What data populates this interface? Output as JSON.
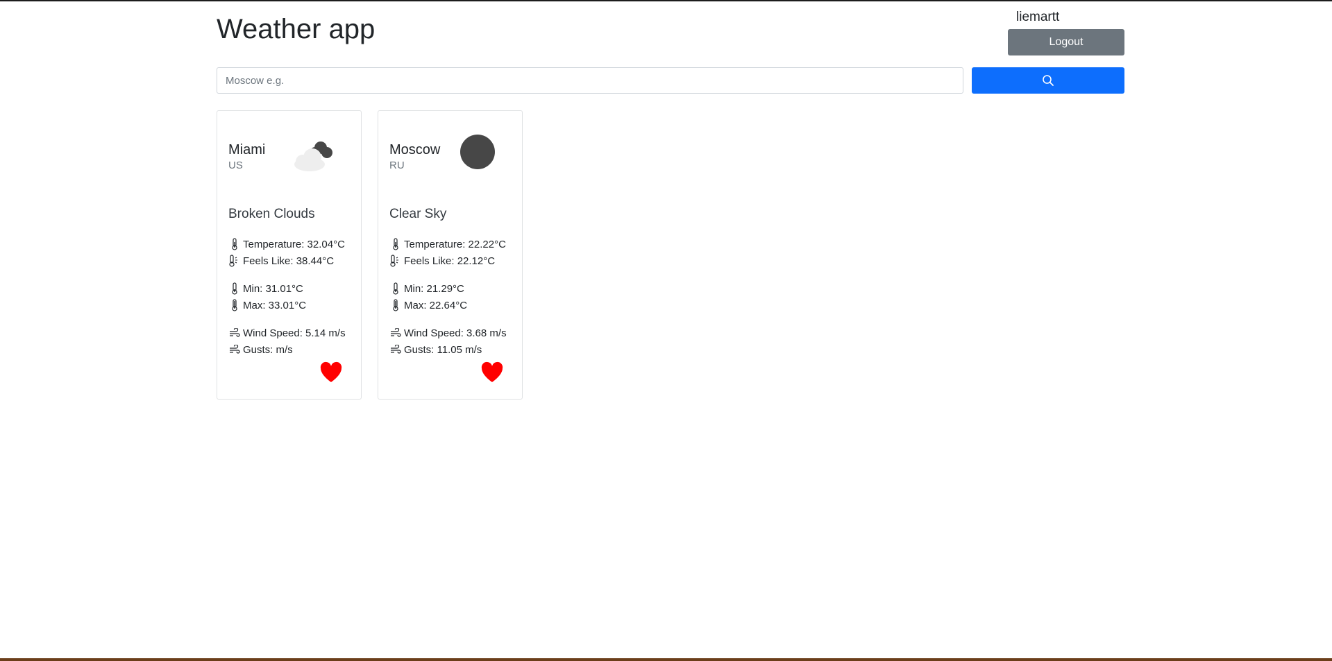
{
  "header": {
    "title": "Weather app",
    "username": "liemartt",
    "logout_label": "Logout"
  },
  "search": {
    "placeholder": "Moscow e.g.",
    "value": "",
    "button_icon": "search-icon"
  },
  "colors": {
    "primary": "#0d6efd",
    "secondary": "#6c757d",
    "favorite": "#ff0000",
    "icon_dark": "#474747"
  },
  "cards": [
    {
      "city": "Miami",
      "country": "US",
      "icon": "broken-clouds-icon",
      "description": "Broken Clouds",
      "temperature": "Temperature: 32.04°C",
      "feels_like": "Feels Like: 38.44°C",
      "min": "Min: 31.01°C",
      "max": "Max: 33.01°C",
      "wind_speed": "Wind Speed: 5.14 m/s",
      "gusts": "Gusts: m/s",
      "favorite_icon": "heart-icon"
    },
    {
      "city": "Moscow",
      "country": "RU",
      "icon": "clear-sky-icon",
      "description": "Clear Sky",
      "temperature": "Temperature: 22.22°C",
      "feels_like": "Feels Like: 22.12°C",
      "min": "Min: 21.29°C",
      "max": "Max: 22.64°C",
      "wind_speed": "Wind Speed: 3.68 m/s",
      "gusts": "Gusts: 11.05 m/s",
      "favorite_icon": "heart-icon"
    }
  ]
}
